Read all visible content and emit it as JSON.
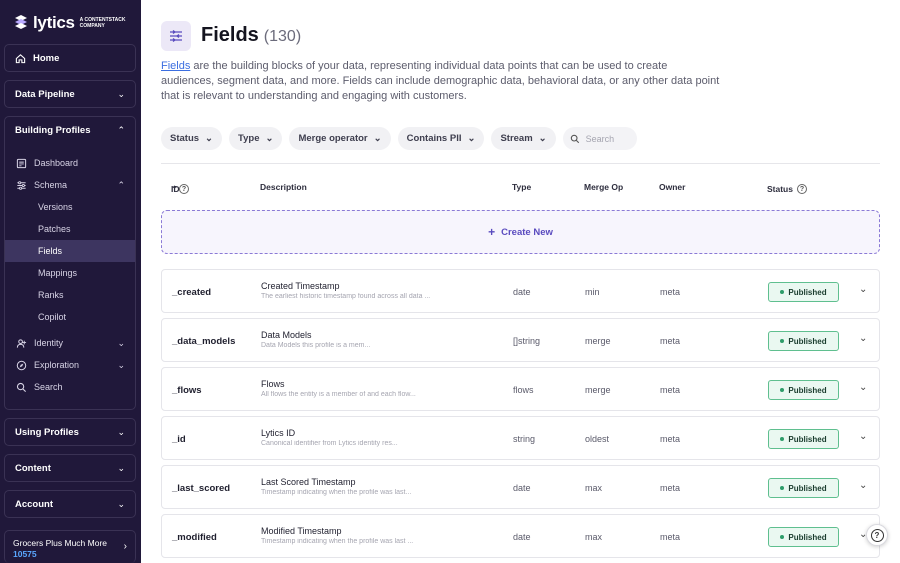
{
  "brand": {
    "name": "lytics",
    "subtitle": "A CONTENTSTACK COMPANY"
  },
  "sidebar": {
    "home": "Home",
    "data_pipeline": "Data Pipeline",
    "building_profiles": {
      "label": "Building Profiles",
      "items": {
        "dashboard": "Dashboard",
        "schema": "Schema",
        "schema_children": [
          "Versions",
          "Patches",
          "Fields",
          "Mappings",
          "Ranks",
          "Copilot"
        ],
        "identity": "Identity",
        "exploration": "Exploration",
        "search": "Search"
      }
    },
    "using_profiles": "Using Profiles",
    "content": "Content",
    "account": "Account",
    "current_account": {
      "name": "Grocers Plus Much More",
      "id": "10575"
    }
  },
  "page": {
    "title": "Fields",
    "count": "(130)",
    "description_link": "Fields",
    "description_rest": " are the building blocks of your data, representing individual data points that can be used to create audiences, segment data, and more. Fields can include demographic data, behavioral data, or any other data point that is relevant to understanding and engaging with customers."
  },
  "filters": [
    "Status",
    "Type",
    "Merge operator",
    "Contains PII",
    "Stream"
  ],
  "search_placeholder": "Search",
  "table": {
    "headers": {
      "id": "ID",
      "description": "Description",
      "type": "Type",
      "merge": "Merge Op",
      "owner": "Owner",
      "status": "Status"
    },
    "create_label": "Create New",
    "rows": [
      {
        "id": "_created",
        "name": "Created Timestamp",
        "desc": "The earliest historic timestamp found across all data ...",
        "type": "date",
        "merge": "min",
        "owner": "meta",
        "status": "Published"
      },
      {
        "id": "_data_models",
        "name": "Data Models",
        "desc": "Data Models this profile is a mem...",
        "type": "[]string",
        "merge": "merge",
        "owner": "meta",
        "status": "Published"
      },
      {
        "id": "_flows",
        "name": "Flows",
        "desc": "All flows the entity is a member of and each flow...",
        "type": "flows",
        "merge": "merge",
        "owner": "meta",
        "status": "Published"
      },
      {
        "id": "_id",
        "name": "Lytics ID",
        "desc": "Canonical identifier from Lytics identity res...",
        "type": "string",
        "merge": "oldest",
        "owner": "meta",
        "status": "Published"
      },
      {
        "id": "_last_scored",
        "name": "Last Scored Timestamp",
        "desc": "Timestamp indicating when the profile was last...",
        "type": "date",
        "merge": "max",
        "owner": "meta",
        "status": "Published"
      },
      {
        "id": "_modified",
        "name": "Modified Timestamp",
        "desc": "Timestamp indicating when the profile was last ...",
        "type": "date",
        "merge": "max",
        "owner": "meta",
        "status": "Published"
      }
    ]
  },
  "colors": {
    "sidebar_bg": "#20183a",
    "accent": "#5a4bbf",
    "published_bg": "#eaf8f1",
    "link": "#3b6ee0"
  }
}
